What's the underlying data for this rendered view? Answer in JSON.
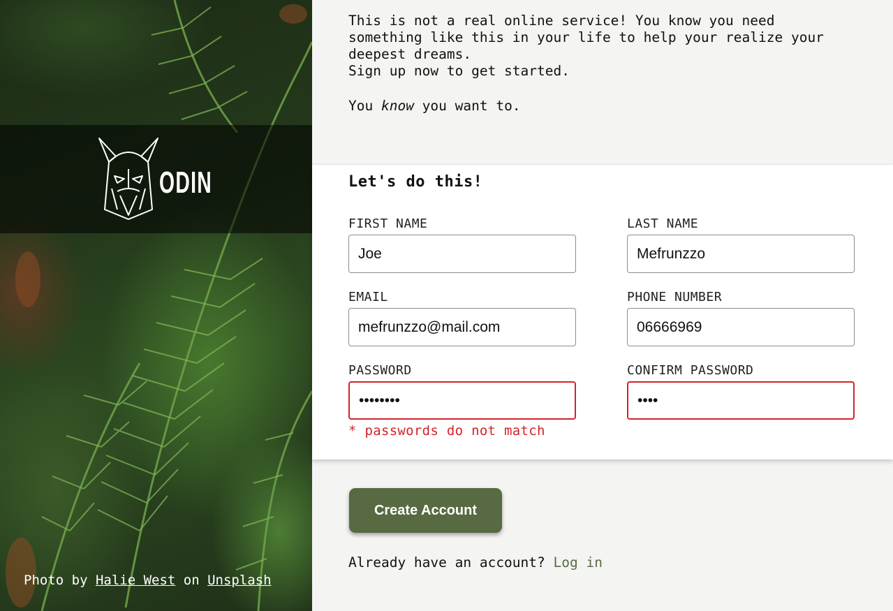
{
  "intro": {
    "line1": "This is not a real online service! You know you need\nsomething like this in your life to help your realize your\ndeepest dreams.\nSign up now to get started.",
    "tagline_before": "You ",
    "tagline_emphasis": "know",
    "tagline_after": " you want to."
  },
  "brand": {
    "logo_text": "ODIN"
  },
  "credit": {
    "prefix": "Photo by ",
    "author": "Halie West",
    "middle": " on ",
    "site": "Unsplash"
  },
  "form": {
    "heading": "Let's do this!",
    "fields": {
      "first_name": {
        "label": "FIRST NAME",
        "value": "Joe"
      },
      "last_name": {
        "label": "LAST NAME",
        "value": "Mefrunzzo"
      },
      "email": {
        "label": "EMAIL",
        "value": "mefrunzzo@mail.com"
      },
      "phone": {
        "label": "PHONE NUMBER",
        "value": "06666969"
      },
      "password": {
        "label": "PASSWORD",
        "value": "12345678"
      },
      "confirm_password": {
        "label": "CONFIRM PASSWORD",
        "value": "1234"
      }
    },
    "error": "* passwords do not match"
  },
  "actions": {
    "create_label": "Create Account",
    "login_prompt": "Already have an account? ",
    "login_link": "Log in"
  },
  "colors": {
    "accent": "#586a42",
    "error": "#d2232a",
    "background": "#f4f4f2"
  }
}
